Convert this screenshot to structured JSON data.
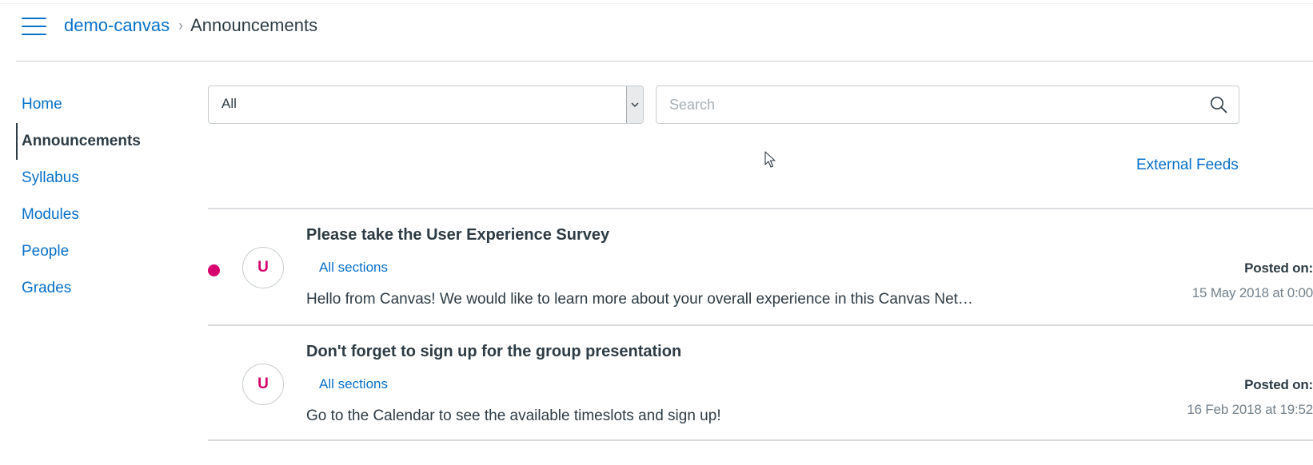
{
  "breadcrumb": {
    "course": "demo-canvas",
    "separator": "›",
    "current": "Announcements"
  },
  "sidebar": {
    "items": [
      {
        "label": "Home"
      },
      {
        "label": "Announcements"
      },
      {
        "label": "Syllabus"
      },
      {
        "label": "Modules"
      },
      {
        "label": "People"
      },
      {
        "label": "Grades"
      }
    ],
    "active": "Announcements"
  },
  "filter": {
    "selected": "All"
  },
  "search": {
    "placeholder": "Search",
    "value": ""
  },
  "external_feeds_label": "External Feeds",
  "announcements": [
    {
      "avatar": "U",
      "title": "Please take the User Experience Survey",
      "sections": "All sections",
      "excerpt": "Hello from Canvas! We would like to learn more about your overall experience in this Canvas Net…",
      "posted_label": "Posted on:",
      "posted_date": "15 May 2018 at 0:00",
      "unread": true
    },
    {
      "avatar": "U",
      "title": "Don't forget to sign up for the group presentation",
      "sections": "All sections",
      "excerpt": "Go to the Calendar to see the available timeslots and sign up!",
      "posted_label": "Posted on:",
      "posted_date": "16 Feb 2018 at 19:52",
      "unread": false
    }
  ],
  "colors": {
    "link": "#0770c9",
    "text": "#2d3b45",
    "accent": "#d6006e",
    "muted": "#73818c"
  },
  "icons": {
    "menu": "hamburger-menu-icon",
    "search": "magnifier-icon",
    "dropdown": "chevron-down-icon",
    "cursor": "mouse-pointer-icon"
  }
}
